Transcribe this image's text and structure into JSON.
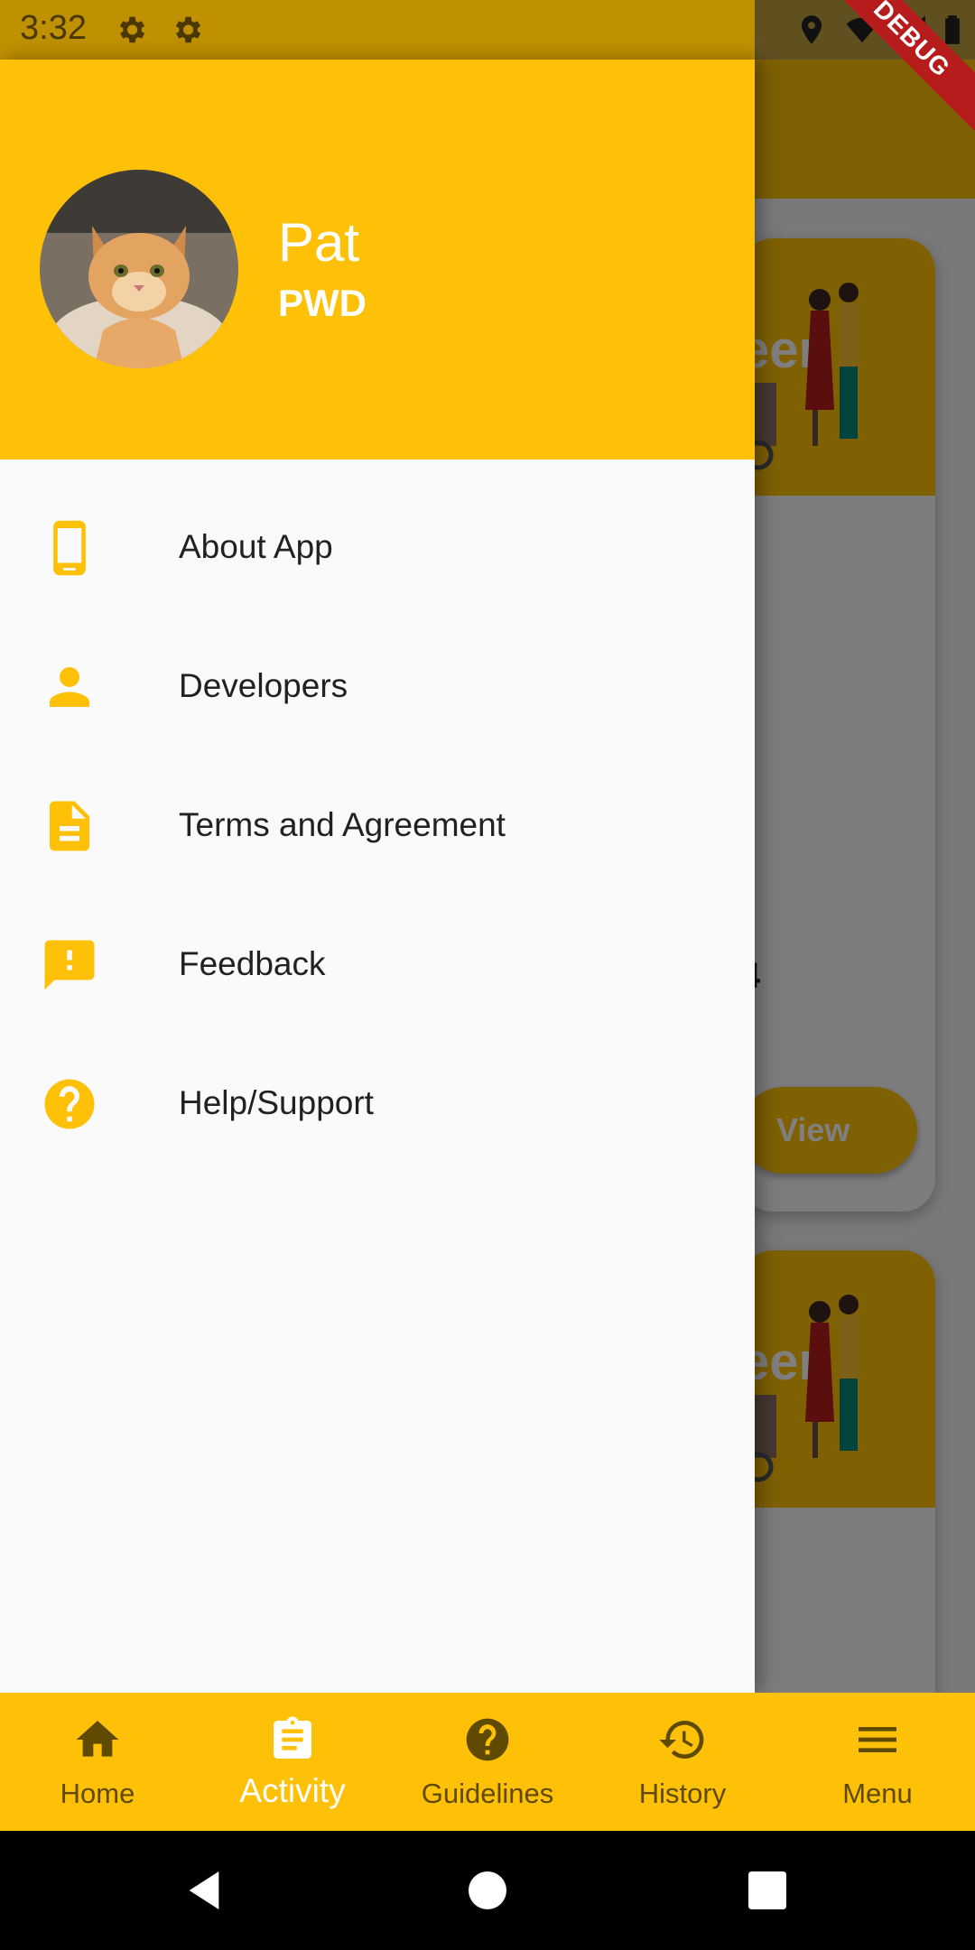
{
  "status_bar": {
    "time": "3:32",
    "debug_label": "DEBUG"
  },
  "background": {
    "card_banner_text": "een",
    "card_number": "4",
    "view_button": "View"
  },
  "drawer": {
    "user_name": "Pat",
    "user_role": "PWD",
    "items": [
      {
        "label": "About App",
        "icon": "phone-icon"
      },
      {
        "label": "Developers",
        "icon": "person-icon"
      },
      {
        "label": "Terms and Agreement",
        "icon": "document-icon"
      },
      {
        "label": "Feedback",
        "icon": "feedback-icon"
      },
      {
        "label": "Help/Support",
        "icon": "help-icon"
      }
    ]
  },
  "bottom_nav": {
    "items": [
      {
        "label": "Home",
        "icon": "home-icon"
      },
      {
        "label": "Activity",
        "icon": "clipboard-icon",
        "active": true
      },
      {
        "label": "Guidelines",
        "icon": "help-icon"
      },
      {
        "label": "History",
        "icon": "history-icon"
      },
      {
        "label": "Menu",
        "icon": "menu-icon"
      }
    ]
  },
  "colors": {
    "accent": "#ffc107",
    "nav_inactive": "#5f4a00",
    "debug": "#b71c1c"
  }
}
